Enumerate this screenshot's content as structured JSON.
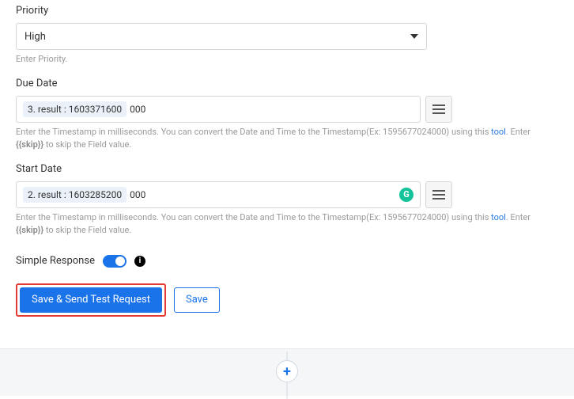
{
  "priority": {
    "label": "Priority",
    "value": "High",
    "hint": "Enter Priority."
  },
  "due_date": {
    "label": "Due Date",
    "chip": "3. result : 1603371600",
    "trail": "000",
    "hint_part1": "Enter the Timestamp in milliseconds. You can convert the Date and Time to the Timestamp(Ex: 1595677024000) using this ",
    "hint_link": "tool",
    "hint_part2": ". Enter ",
    "hint_bold": "{{skip}}",
    "hint_part3": " to skip the Field value."
  },
  "start_date": {
    "label": "Start Date",
    "chip": "2. result : 1603285200",
    "trail": "000",
    "hint_part1": "Enter the Timestamp in milliseconds. You can convert the Date and Time to the Timestamp(Ex: 1595677024000) using this ",
    "hint_link": "tool",
    "hint_part2": ". Enter ",
    "hint_bold": "{{skip}}",
    "hint_part3": " to skip the Field value."
  },
  "simple_response": {
    "label": "Simple Response"
  },
  "buttons": {
    "primary": "Save & Send Test Request",
    "secondary": "Save"
  },
  "icons": {
    "grammarly": "G",
    "info": "i",
    "plus": "+"
  }
}
